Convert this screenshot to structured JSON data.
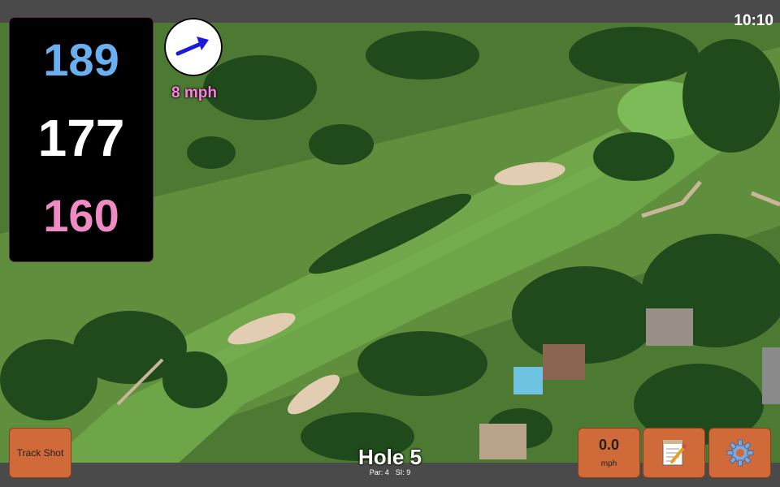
{
  "status": {
    "time": "10:10"
  },
  "distances": {
    "back": "189",
    "middle": "177",
    "front": "160"
  },
  "wind": {
    "speed": "8 mph",
    "direction": "east-northeast",
    "arrow_color": "#1a1adb"
  },
  "hole": {
    "title": "Hole 5",
    "par": "Par: 4",
    "stroke_index": "SI: 9"
  },
  "buttons": {
    "track_shot": "Track Shot",
    "speed_value": "0.0",
    "speed_unit": "mph",
    "notes_icon": "notepad-icon",
    "settings_icon": "gear-icon"
  },
  "colors": {
    "button_bg": "#d06a38",
    "back_distance": "#6ab0f0",
    "middle_distance": "#ffffff",
    "front_distance": "#f08ac4",
    "wind_text": "#ff7fe0"
  }
}
